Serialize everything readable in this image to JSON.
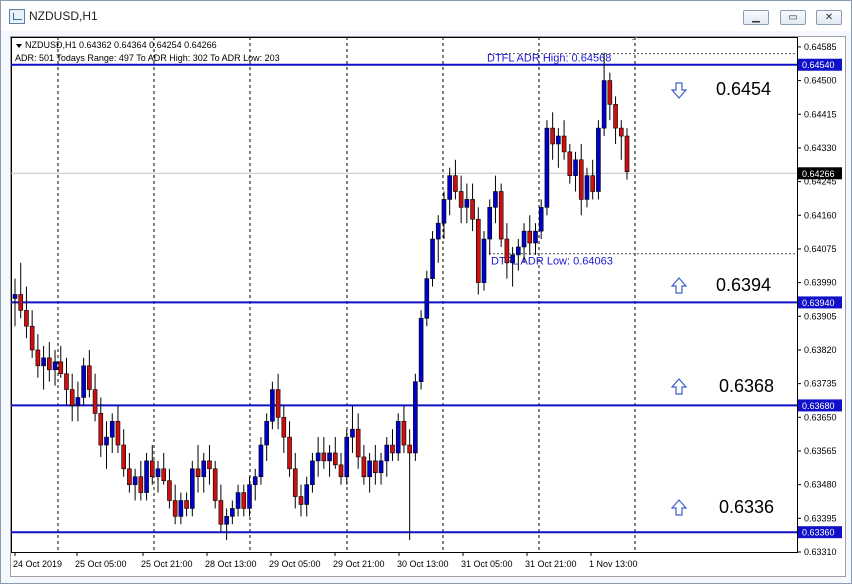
{
  "window": {
    "title": "NZDUSD,H1",
    "min_label": "▁",
    "max_label": "▭",
    "close_label": "✕"
  },
  "chart_data": {
    "type": "candlestick",
    "symbol_line": "NZDUSD,H1  0.64362 0.64364 0.64254 0.64266",
    "adr_line": "ADR: 501  Todays Range: 497  To ADR High: 302  To ADR Low: 203",
    "ylim": [
      0.6331,
      0.6461
    ],
    "price_ticks": [
      "0.64585",
      "0.64500",
      "0.64415",
      "0.64330",
      "0.64245",
      "0.64160",
      "0.64075",
      "0.63990",
      "0.63905",
      "0.63820",
      "0.63735",
      "0.63650",
      "0.63565",
      "0.63480",
      "0.63395",
      "0.63310"
    ],
    "time_ticks": [
      "24 Oct 2019",
      "25 Oct 05:00",
      "25 Oct 21:00",
      "28 Oct 13:00",
      "29 Oct 05:00",
      "29 Oct 21:00",
      "30 Oct 13:00",
      "31 Oct 05:00",
      "31 Oct 21:00",
      "1 Nov 13:00"
    ],
    "current_price": {
      "value": 0.64266,
      "label": "0.64266"
    },
    "levels": [
      {
        "value": 0.6454,
        "label": "0.64540",
        "zone_label": "0.6454",
        "arrow": "down"
      },
      {
        "value": 0.6394,
        "label": "0.63940",
        "zone_label": "0.6394",
        "arrow": "up"
      },
      {
        "value": 0.6368,
        "label": "0.63680",
        "zone_label": "0.6368",
        "arrow": "up"
      },
      {
        "value": 0.6336,
        "label": "0.63360",
        "zone_label": "0.6336",
        "arrow": "up"
      }
    ],
    "adr_high": {
      "value": 0.64568,
      "label": "DTFL ADR High: 0.64568"
    },
    "adr_low": {
      "value": 0.64063,
      "label": "DTFL ADR Low: 0.64063"
    },
    "candles": [
      [
        0.6395,
        0.64,
        0.6388,
        0.6396
      ],
      [
        0.6396,
        0.6404,
        0.639,
        0.6392
      ],
      [
        0.6392,
        0.6398,
        0.6385,
        0.6388
      ],
      [
        0.6388,
        0.6392,
        0.638,
        0.6382
      ],
      [
        0.6382,
        0.6386,
        0.6375,
        0.6378
      ],
      [
        0.6378,
        0.6383,
        0.6372,
        0.638
      ],
      [
        0.638,
        0.6384,
        0.6374,
        0.6377
      ],
      [
        0.6377,
        0.6382,
        0.6373,
        0.6379
      ],
      [
        0.6379,
        0.6383,
        0.6375,
        0.6376
      ],
      [
        0.6376,
        0.638,
        0.6368,
        0.6372
      ],
      [
        0.6372,
        0.6376,
        0.6364,
        0.6368
      ],
      [
        0.6368,
        0.6374,
        0.6364,
        0.637
      ],
      [
        0.637,
        0.638,
        0.6368,
        0.6378
      ],
      [
        0.6378,
        0.6382,
        0.637,
        0.6372
      ],
      [
        0.6372,
        0.6376,
        0.6364,
        0.6366
      ],
      [
        0.6366,
        0.637,
        0.6355,
        0.6358
      ],
      [
        0.6358,
        0.6364,
        0.6352,
        0.636
      ],
      [
        0.636,
        0.6366,
        0.6356,
        0.6364
      ],
      [
        0.6364,
        0.6368,
        0.6356,
        0.6358
      ],
      [
        0.6358,
        0.6362,
        0.635,
        0.6352
      ],
      [
        0.6352,
        0.6356,
        0.6346,
        0.6348
      ],
      [
        0.6348,
        0.6352,
        0.6344,
        0.635
      ],
      [
        0.635,
        0.6354,
        0.6344,
        0.6346
      ],
      [
        0.6346,
        0.6356,
        0.6344,
        0.6354
      ],
      [
        0.6354,
        0.6358,
        0.6348,
        0.635
      ],
      [
        0.635,
        0.6354,
        0.6346,
        0.6352
      ],
      [
        0.6352,
        0.6356,
        0.6348,
        0.6349
      ],
      [
        0.6349,
        0.6352,
        0.6342,
        0.6344
      ],
      [
        0.6344,
        0.6348,
        0.6338,
        0.634
      ],
      [
        0.634,
        0.6346,
        0.6338,
        0.6344
      ],
      [
        0.6344,
        0.6346,
        0.634,
        0.6342
      ],
      [
        0.6342,
        0.6354,
        0.634,
        0.6352
      ],
      [
        0.6352,
        0.6358,
        0.6346,
        0.635
      ],
      [
        0.635,
        0.6356,
        0.6346,
        0.6354
      ],
      [
        0.6354,
        0.6358,
        0.6348,
        0.6352
      ],
      [
        0.6352,
        0.6354,
        0.6342,
        0.6344
      ],
      [
        0.6344,
        0.6348,
        0.6336,
        0.6338
      ],
      [
        0.6338,
        0.6342,
        0.6334,
        0.634
      ],
      [
        0.634,
        0.6344,
        0.6338,
        0.6342
      ],
      [
        0.6342,
        0.6348,
        0.634,
        0.6346
      ],
      [
        0.6346,
        0.6348,
        0.634,
        0.6342
      ],
      [
        0.6342,
        0.635,
        0.634,
        0.6348
      ],
      [
        0.6348,
        0.6352,
        0.6344,
        0.635
      ],
      [
        0.635,
        0.636,
        0.6348,
        0.6358
      ],
      [
        0.6358,
        0.6366,
        0.6354,
        0.6364
      ],
      [
        0.6364,
        0.6374,
        0.6362,
        0.6372
      ],
      [
        0.6372,
        0.6376,
        0.6362,
        0.6365
      ],
      [
        0.6365,
        0.6368,
        0.6356,
        0.636
      ],
      [
        0.636,
        0.6364,
        0.635,
        0.6352
      ],
      [
        0.6352,
        0.6356,
        0.6342,
        0.6345
      ],
      [
        0.6345,
        0.6348,
        0.634,
        0.6343
      ],
      [
        0.6343,
        0.635,
        0.634,
        0.6348
      ],
      [
        0.6348,
        0.6356,
        0.6346,
        0.6354
      ],
      [
        0.6354,
        0.636,
        0.635,
        0.6356
      ],
      [
        0.6356,
        0.636,
        0.6352,
        0.6354
      ],
      [
        0.6354,
        0.6358,
        0.635,
        0.6356
      ],
      [
        0.6356,
        0.636,
        0.6352,
        0.6353
      ],
      [
        0.6353,
        0.6356,
        0.6348,
        0.635
      ],
      [
        0.635,
        0.6362,
        0.6348,
        0.636
      ],
      [
        0.636,
        0.6368,
        0.6356,
        0.6362
      ],
      [
        0.6362,
        0.6366,
        0.6352,
        0.6355
      ],
      [
        0.6355,
        0.6358,
        0.6348,
        0.635
      ],
      [
        0.635,
        0.6356,
        0.6346,
        0.6354
      ],
      [
        0.6354,
        0.6358,
        0.6348,
        0.6351
      ],
      [
        0.6351,
        0.6356,
        0.6348,
        0.6354
      ],
      [
        0.6354,
        0.636,
        0.635,
        0.6358
      ],
      [
        0.6358,
        0.6362,
        0.6354,
        0.6356
      ],
      [
        0.6356,
        0.6366,
        0.6354,
        0.6364
      ],
      [
        0.6364,
        0.6368,
        0.6356,
        0.6358
      ],
      [
        0.6358,
        0.6362,
        0.6334,
        0.6356
      ],
      [
        0.6356,
        0.6376,
        0.6354,
        0.6374
      ],
      [
        0.6374,
        0.6392,
        0.6372,
        0.639
      ],
      [
        0.639,
        0.6402,
        0.6388,
        0.64
      ],
      [
        0.64,
        0.6412,
        0.6398,
        0.641
      ],
      [
        0.641,
        0.6416,
        0.6404,
        0.6414
      ],
      [
        0.6414,
        0.6422,
        0.641,
        0.642
      ],
      [
        0.642,
        0.6428,
        0.6416,
        0.6426
      ],
      [
        0.6426,
        0.643,
        0.642,
        0.6422
      ],
      [
        0.6422,
        0.6426,
        0.6414,
        0.6418
      ],
      [
        0.6418,
        0.6424,
        0.6414,
        0.642
      ],
      [
        0.642,
        0.6424,
        0.6412,
        0.6415
      ],
      [
        0.6415,
        0.6418,
        0.6396,
        0.6399
      ],
      [
        0.6399,
        0.6412,
        0.6397,
        0.641
      ],
      [
        0.641,
        0.642,
        0.6406,
        0.6418
      ],
      [
        0.6418,
        0.6426,
        0.6414,
        0.6422
      ],
      [
        0.6422,
        0.6424,
        0.6408,
        0.641
      ],
      [
        0.641,
        0.6414,
        0.64,
        0.6404
      ],
      [
        0.6404,
        0.6408,
        0.6398,
        0.6406
      ],
      [
        0.6406,
        0.641,
        0.6402,
        0.6408
      ],
      [
        0.6408,
        0.6414,
        0.6404,
        0.6412
      ],
      [
        0.6412,
        0.6416,
        0.6406,
        0.6409
      ],
      [
        0.6409,
        0.6414,
        0.6406,
        0.6412
      ],
      [
        0.6412,
        0.642,
        0.641,
        0.6418
      ],
      [
        0.6418,
        0.644,
        0.6416,
        0.6438
      ],
      [
        0.6438,
        0.6442,
        0.643,
        0.6434
      ],
      [
        0.6434,
        0.6438,
        0.6428,
        0.6436
      ],
      [
        0.6436,
        0.644,
        0.643,
        0.6432
      ],
      [
        0.6432,
        0.6434,
        0.6424,
        0.6426
      ],
      [
        0.6426,
        0.6432,
        0.6422,
        0.643
      ],
      [
        0.643,
        0.6434,
        0.6416,
        0.642
      ],
      [
        0.642,
        0.6428,
        0.6418,
        0.6426
      ],
      [
        0.6426,
        0.643,
        0.642,
        0.6422
      ],
      [
        0.6422,
        0.644,
        0.642,
        0.6438
      ],
      [
        0.6438,
        0.6457,
        0.6436,
        0.645
      ],
      [
        0.645,
        0.6452,
        0.644,
        0.6444
      ],
      [
        0.6444,
        0.6446,
        0.6434,
        0.6438
      ],
      [
        0.6438,
        0.644,
        0.643,
        0.6436
      ],
      [
        0.6436,
        0.6438,
        0.6425,
        0.6427
      ]
    ]
  }
}
